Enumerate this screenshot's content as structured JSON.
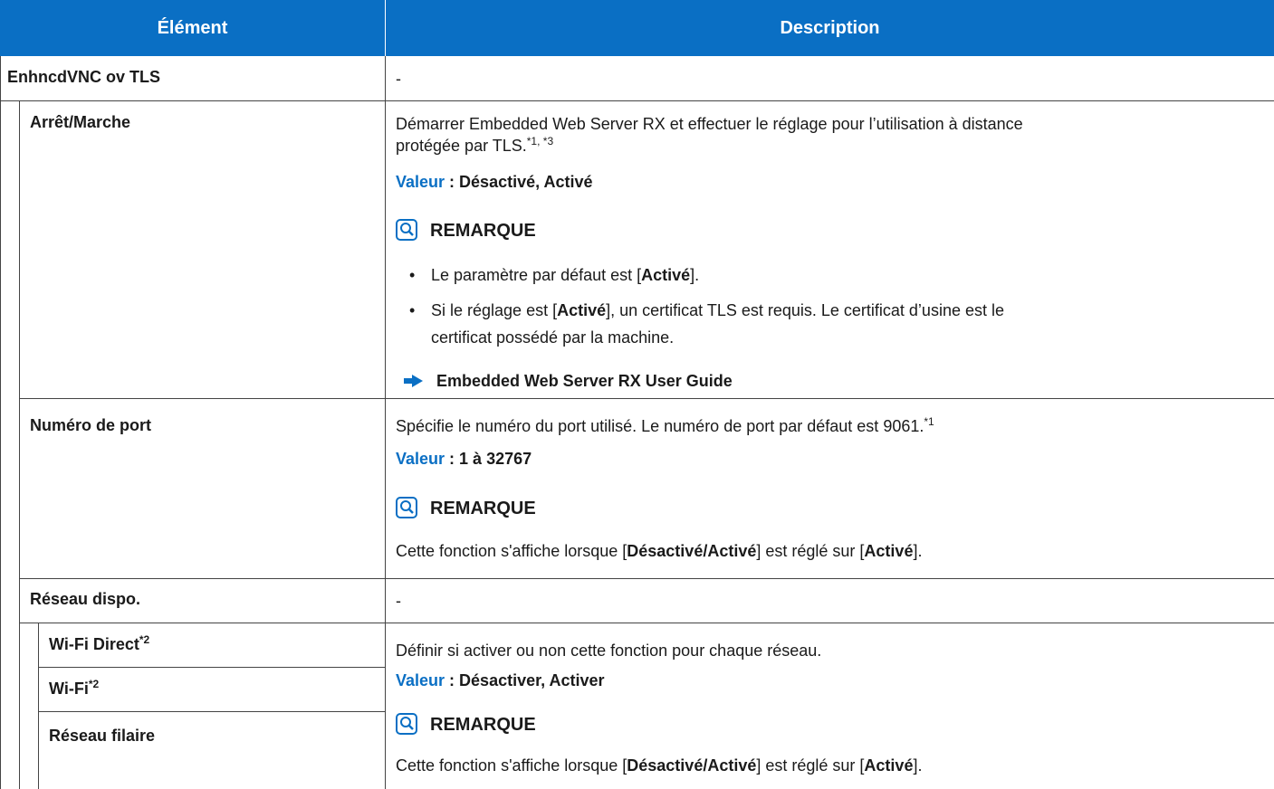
{
  "table": {
    "headers": {
      "element": "Élément",
      "description": "Description"
    }
  },
  "rows": {
    "enhanced_vnc": {
      "label": "EnhncdVNC ov TLS",
      "description": "-"
    },
    "on_off": {
      "label": "Arrêt/Marche",
      "desc_line1": "Démarrer Embedded Web Server RX et effectuer le réglage pour l’utilisation à distance",
      "desc_line2": "protégée par TLS.",
      "desc_sup": "*1, *3",
      "value_label": "Valeur",
      "value_sep": " : ",
      "value": "Désactivé, Activé",
      "note_title": "REMARQUE",
      "bullet1_pre": "Le paramètre par défaut est [",
      "bullet1_bold": "Activé",
      "bullet1_post": "].",
      "bullet2_pre": "Si le réglage est [",
      "bullet2_bold": "Activé",
      "bullet2_post_line1": "], un certificat TLS est requis. Le certificat d’usine est le",
      "bullet2_line2": "certificat possédé par la machine.",
      "reference": "Embedded Web Server RX User Guide"
    },
    "port_number": {
      "label": "Numéro de port",
      "desc": "Spécifie le numéro du port utilisé. Le numéro de port par défaut est 9061.",
      "desc_sup": "*1",
      "value_label": "Valeur",
      "value_sep": " : ",
      "value": "1 à 32767",
      "note_title": "REMARQUE",
      "note_pre": "Cette fonction s'affiche lorsque [",
      "note_bold1": "Désactivé/Activé",
      "note_mid": "] est réglé sur [",
      "note_bold2": "Activé",
      "note_post": "]."
    },
    "network": {
      "label": "Réseau dispo.",
      "description": "-"
    },
    "wifi_direct": {
      "label": "Wi-Fi Direct",
      "sup": "*2"
    },
    "wifi": {
      "label": "Wi-Fi",
      "sup": "*2"
    },
    "wired": {
      "label": "Réseau filaire"
    },
    "network_desc": {
      "desc": "Définir si activer ou non cette fonction pour chaque réseau.",
      "value_label": "Valeur",
      "value_sep": " : ",
      "value": "Désactiver, Activer",
      "note_title": "REMARQUE",
      "note_pre": "Cette fonction s'affiche lorsque [",
      "note_bold1": "Désactivé/Activé",
      "note_mid": "] est réglé sur [",
      "note_bold2": "Activé",
      "note_post": "]."
    }
  },
  "colors": {
    "header_bg": "#0a6fc4",
    "accent_text": "#0a6fc4",
    "border": "#444444"
  },
  "icons": {
    "note": "lightbulb-magnifier-icon",
    "reference": "arrow-right-icon"
  }
}
